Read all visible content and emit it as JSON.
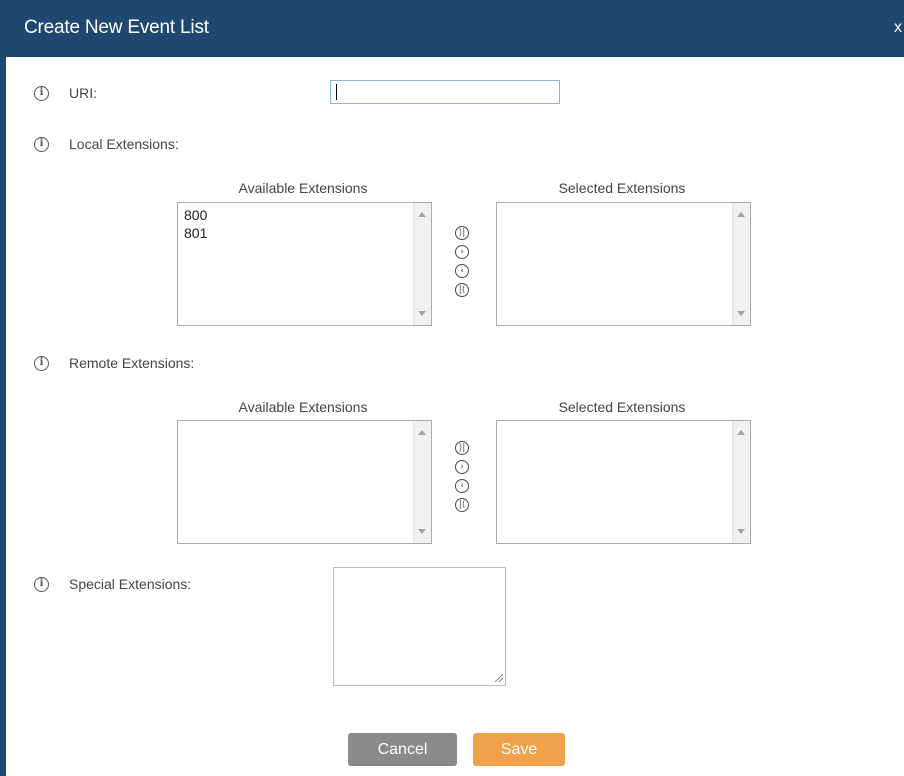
{
  "dialog": {
    "title": "Create New Event List",
    "close_label": "x"
  },
  "uri": {
    "label": "URI:",
    "value": ""
  },
  "local_extensions": {
    "label": "Local Extensions:",
    "available_header": "Available Extensions",
    "selected_header": "Selected Extensions",
    "available_items": [
      "800",
      "801"
    ],
    "selected_items": []
  },
  "remote_extensions": {
    "label": "Remote Extensions:",
    "available_header": "Available Extensions",
    "selected_header": "Selected Extensions",
    "available_items": [],
    "selected_items": []
  },
  "special_extensions": {
    "label": "Special Extensions:",
    "value": ""
  },
  "move_buttons": {
    "add_all": "⟩|",
    "add": "›",
    "remove": "‹",
    "remove_all": "|⟨"
  },
  "footer": {
    "cancel_label": "Cancel",
    "save_label": "Save"
  },
  "colors": {
    "header_bg": "#1e4870",
    "save_bg": "#f0a24b",
    "cancel_bg": "#8a8a8a"
  },
  "icons": {
    "info": "info-circle-icon",
    "add_all": "move-all-right-icon",
    "add": "move-right-icon",
    "remove": "move-left-icon",
    "remove_all": "move-all-left-icon"
  }
}
